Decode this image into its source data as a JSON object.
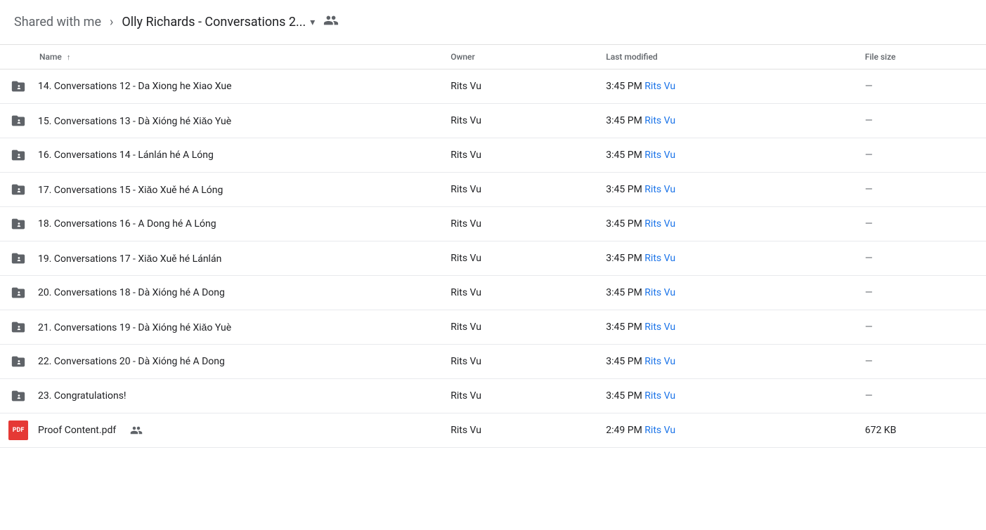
{
  "header": {
    "breadcrumb_root": "Shared with me",
    "breadcrumb_current": "Olly Richards - Conversations 2...",
    "people_icon": "👥"
  },
  "table": {
    "columns": {
      "name": "Name",
      "sort_indicator": "↑",
      "owner": "Owner",
      "last_modified": "Last modified",
      "file_size": "File size"
    },
    "rows": [
      {
        "id": "row-14",
        "type": "folder",
        "name": "14. Conversations 12 - Da Xiong he Xiao Xue",
        "owner": "Rits Vu",
        "modified": "3:45 PM",
        "modified_by": "Rits Vu",
        "size": "—"
      },
      {
        "id": "row-15",
        "type": "folder",
        "name": "15. Conversations 13 - Dà Xióng hé Xiǎo Yuè",
        "owner": "Rits Vu",
        "modified": "3:45 PM",
        "modified_by": "Rits Vu",
        "size": "—"
      },
      {
        "id": "row-16",
        "type": "folder",
        "name": "16. Conversations 14 - Lánlán hé A Lóng",
        "owner": "Rits Vu",
        "modified": "3:45 PM",
        "modified_by": "Rits Vu",
        "size": "—"
      },
      {
        "id": "row-17",
        "type": "folder",
        "name": "17. Conversations 15 - Xiǎo Xuě hé A Lóng",
        "owner": "Rits Vu",
        "modified": "3:45 PM",
        "modified_by": "Rits Vu",
        "size": "—"
      },
      {
        "id": "row-18",
        "type": "folder",
        "name": "18. Conversations 16 - A Dong hé A Lóng",
        "owner": "Rits Vu",
        "modified": "3:45 PM",
        "modified_by": "Rits Vu",
        "size": "—"
      },
      {
        "id": "row-19",
        "type": "folder",
        "name": "19. Conversations 17 - Xiǎo Xuě hé Lánlán",
        "owner": "Rits Vu",
        "modified": "3:45 PM",
        "modified_by": "Rits Vu",
        "size": "—"
      },
      {
        "id": "row-20",
        "type": "folder",
        "name": "20. Conversations 18 - Dà Xióng hé A Dong",
        "owner": "Rits Vu",
        "modified": "3:45 PM",
        "modified_by": "Rits Vu",
        "size": "—"
      },
      {
        "id": "row-21",
        "type": "folder",
        "name": "21. Conversations 19 - Dà Xióng hé Xiǎo Yuè",
        "owner": "Rits Vu",
        "modified": "3:45 PM",
        "modified_by": "Rits Vu",
        "size": "—"
      },
      {
        "id": "row-22",
        "type": "folder",
        "name": "22. Conversations 20 - Dà Xióng hé A Dong",
        "owner": "Rits Vu",
        "modified": "3:45 PM",
        "modified_by": "Rits Vu",
        "size": "—"
      },
      {
        "id": "row-23",
        "type": "folder",
        "name": "23. Congratulations!",
        "owner": "Rits Vu",
        "modified": "3:45 PM",
        "modified_by": "Rits Vu",
        "size": "—"
      },
      {
        "id": "row-pdf",
        "type": "pdf",
        "name": "Proof Content.pdf",
        "shared": true,
        "owner": "Rits Vu",
        "modified": "2:49 PM",
        "modified_by": "Rits Vu",
        "size": "672 KB"
      }
    ]
  }
}
